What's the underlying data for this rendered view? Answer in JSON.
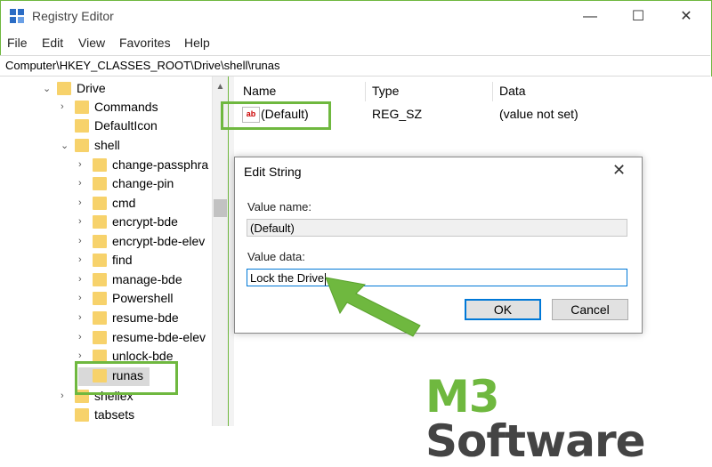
{
  "window": {
    "title": "Registry Editor",
    "controls": {
      "minimize": "—",
      "maximize": "☐",
      "close": "✕"
    }
  },
  "menu": [
    "File",
    "Edit",
    "View",
    "Favorites",
    "Help"
  ],
  "address": "Computer\\HKEY_CLASSES_ROOT\\Drive\\shell\\runas",
  "tree": [
    {
      "label": "Drive",
      "chevron": "⌄"
    },
    {
      "label": "Commands",
      "chevron": "›"
    },
    {
      "label": "DefaultIcon",
      "chevron": ""
    },
    {
      "label": "shell",
      "chevron": "⌄"
    },
    {
      "label": "change-passphra",
      "chevron": "›"
    },
    {
      "label": "change-pin",
      "chevron": "›"
    },
    {
      "label": "cmd",
      "chevron": "›"
    },
    {
      "label": "encrypt-bde",
      "chevron": "›"
    },
    {
      "label": "encrypt-bde-elev",
      "chevron": "›"
    },
    {
      "label": "find",
      "chevron": "›"
    },
    {
      "label": "manage-bde",
      "chevron": "›"
    },
    {
      "label": "Powershell",
      "chevron": "›"
    },
    {
      "label": "resume-bde",
      "chevron": "›"
    },
    {
      "label": "resume-bde-elev",
      "chevron": "›"
    },
    {
      "label": "unlock-bde",
      "chevron": "›"
    },
    {
      "label": "runas",
      "chevron": ""
    },
    {
      "label": "shellex",
      "chevron": "›"
    },
    {
      "label": "tabsets",
      "chevron": ""
    }
  ],
  "values_table": {
    "columns": [
      "Name",
      "Type",
      "Data"
    ],
    "rows": [
      {
        "icon": "ab",
        "name": "(Default)",
        "type": "REG_SZ",
        "data": "(value not set)"
      }
    ]
  },
  "dialog": {
    "title": "Edit String",
    "close": "✕",
    "value_name_label": "Value name:",
    "value_name": "(Default)",
    "value_data_label": "Value data:",
    "value_data": "Lock the Drive",
    "ok": "OK",
    "cancel": "Cancel"
  },
  "watermark": {
    "m3": "M3",
    "software": "Software"
  },
  "colors": {
    "highlight": "#6fb83f",
    "arrow": "#6fb83f",
    "focus": "#0078d7"
  }
}
